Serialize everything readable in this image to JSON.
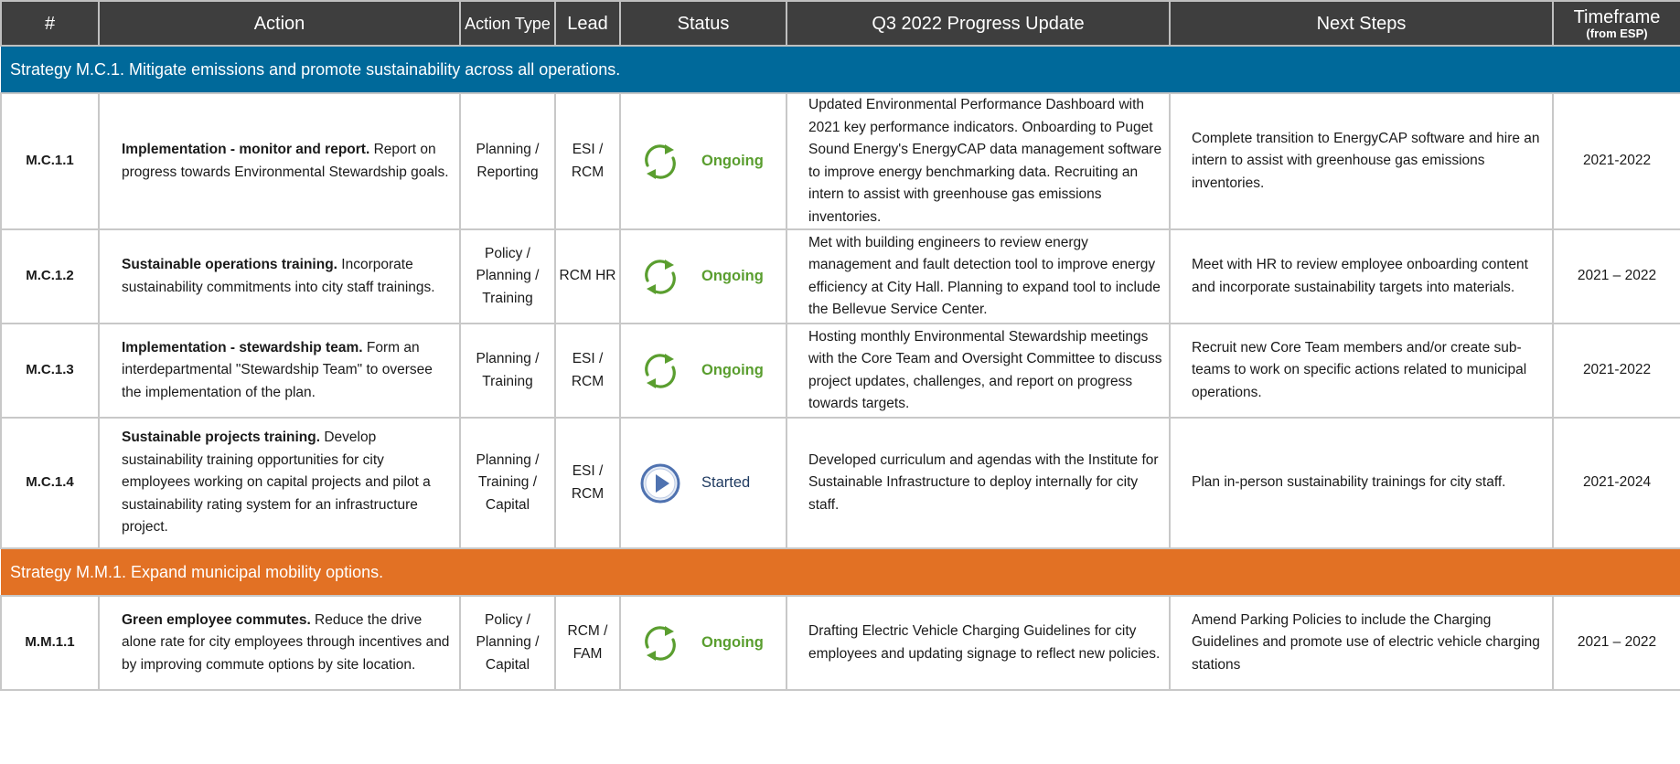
{
  "headers": {
    "num": "#",
    "action": "Action",
    "action_type": "Action Type",
    "lead": "Lead",
    "status": "Status",
    "update": "Q3 2022 Progress Update",
    "next": "Next Steps",
    "timeframe": "Timeframe",
    "timeframe_sub": "(from ESP)"
  },
  "colors": {
    "header_bg": "#3e3e3e",
    "strategy_blue": "#00699a",
    "strategy_orange": "#e27124",
    "ongoing_green": "#5a9e2f",
    "started_navy": "#1f3a60"
  },
  "strategies": [
    {
      "label": "Strategy M.C.1. Mitigate emissions and promote sustainability across all operations.",
      "rows": [
        {
          "num": "M.C.1.1",
          "action_title": "Implementation - monitor and report.",
          "action_text": " Report on progress towards Environmental Stewardship goals.",
          "action_type": "Planning / Reporting",
          "lead": "ESI / RCM",
          "status_icon": "recycle-arrows-icon",
          "status": "Ongoing",
          "update": "Updated Environmental Performance Dashboard with 2021 key performance indicators. Onboarding to Puget Sound Energy's EnergyCAP data management software to improve energy benchmarking data. Recruiting an intern to assist with greenhouse gas emissions inventories.",
          "next": "Complete transition to EnergyCAP software and hire an intern to assist with greenhouse gas emissions inventories.",
          "timeframe": "2021-2022"
        },
        {
          "num": "M.C.1.2",
          "action_title": "Sustainable operations training.",
          "action_text": " Incorporate sustainability commitments into city staff trainings.",
          "action_type": "Policy / Planning / Training",
          "lead": "RCM HR",
          "status_icon": "recycle-arrows-icon",
          "status": "Ongoing",
          "update": "Met with building engineers to review energy management and fault detection tool to improve energy efficiency at City Hall. Planning to expand tool to include the Bellevue Service Center.",
          "next": "Meet with HR to review employee onboarding content and incorporate sustainability targets into materials.",
          "timeframe": "2021 – 2022"
        },
        {
          "num": "M.C.1.3",
          "action_title": "Implementation - stewardship team.",
          "action_text": " Form an interdepartmental \"Stewardship Team\" to oversee the implementation of the plan.",
          "action_type": "Planning / Training",
          "lead": "ESI / RCM",
          "status_icon": "recycle-arrows-icon",
          "status": "Ongoing",
          "update": "Hosting monthly Environmental Stewardship meetings with the Core Team and Oversight Committee to discuss project updates, challenges, and report on progress towards targets.",
          "next": "Recruit new Core Team members and/or create sub-teams to work on specific actions related to municipal operations.",
          "timeframe": "2021-2022"
        },
        {
          "num": "M.C.1.4",
          "action_title": "Sustainable projects training.",
          "action_text": " Develop sustainability training opportunities for city employees working on capital projects and pilot a sustainability rating system for an infrastructure project.",
          "action_type": "Planning / Training / Capital",
          "lead": "ESI / RCM",
          "status_icon": "play-circle-icon",
          "status": "Started",
          "update": "Developed curriculum and agendas with the Institute for Sustainable Infrastructure to deploy internally for city staff.",
          "next": "Plan in-person sustainability trainings for city staff.",
          "timeframe": "2021-2024"
        }
      ]
    },
    {
      "label": "Strategy M.M.1. Expand municipal mobility options.",
      "rows": [
        {
          "num": "M.M.1.1",
          "action_title": "Green employee commutes.",
          "action_text": "  Reduce the drive alone rate for city employees through incentives and by improving commute options by site location.",
          "action_type": "Policy / Planning / Capital",
          "lead": "RCM / FAM",
          "status_icon": "recycle-arrows-icon",
          "status": "Ongoing",
          "update": "Drafting Electric Vehicle Charging Guidelines for city employees and updating signage to reflect new policies.",
          "next": "Amend Parking Policies to include the Charging Guidelines and promote use of electric vehicle charging stations",
          "timeframe": "2021 – 2022"
        }
      ]
    }
  ]
}
